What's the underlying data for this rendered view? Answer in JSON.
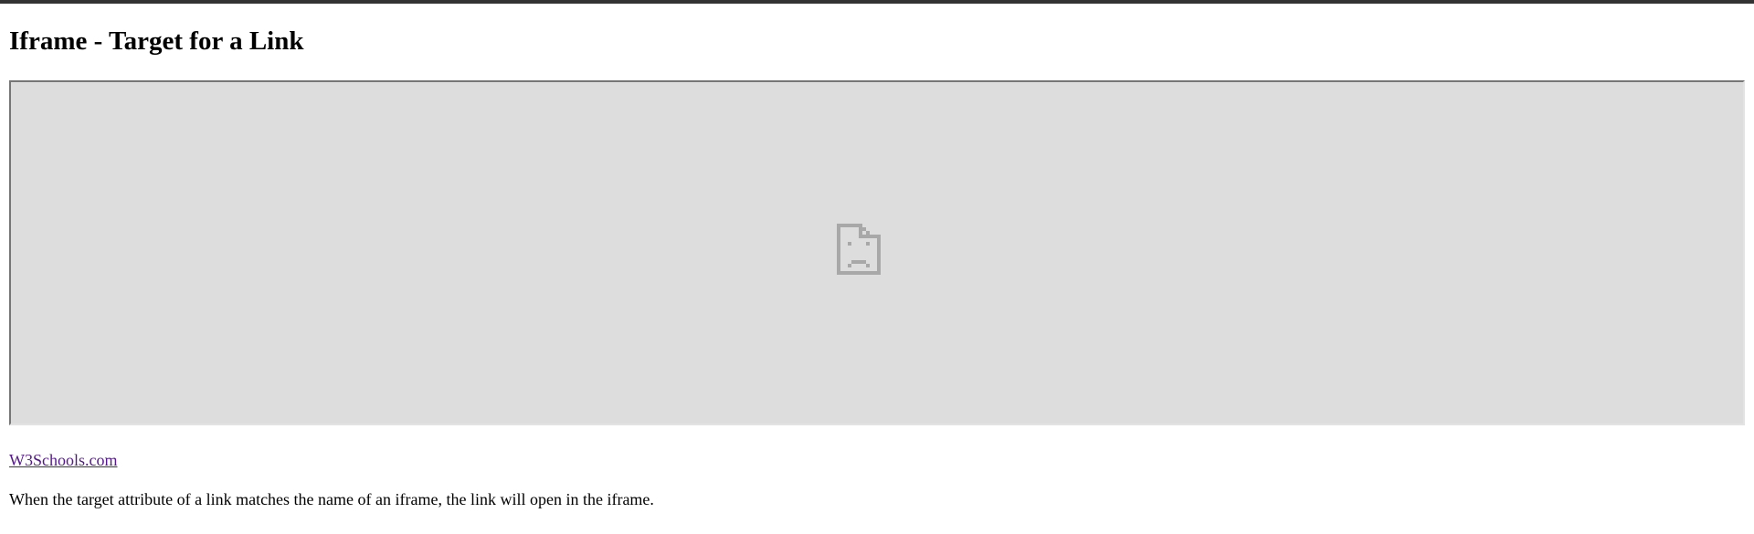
{
  "page": {
    "title": "Iframe - Target for a Link",
    "link_text": "W3Schools.com",
    "description": "When the target attribute of a link matches the name of an iframe, the link will open in the iframe."
  },
  "iframe": {
    "state": "failed to load",
    "icon": "broken-page-icon",
    "background_color": "#dddddd",
    "icon_color": "#a8a8a8"
  },
  "colors": {
    "top_bar": "#333333",
    "link_visited": "#551a8b",
    "text": "#000000"
  }
}
